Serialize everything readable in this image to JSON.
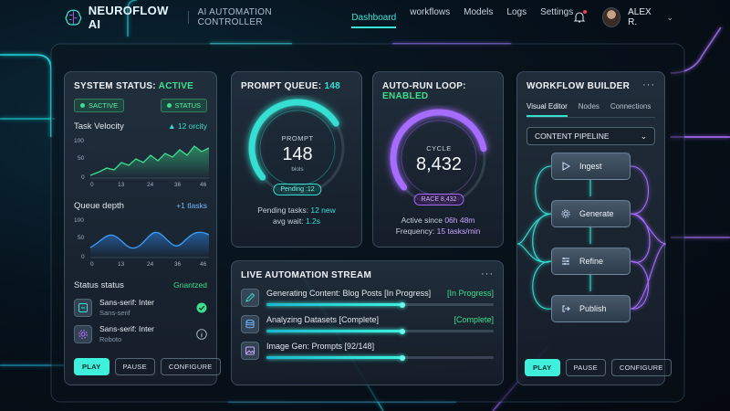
{
  "app": {
    "brand": "NEUROFLOW AI",
    "subtitle": "AI AUTOMATION CONTROLLER",
    "nav": [
      "Dashboard",
      "workflows",
      "Models",
      "Logs",
      "Settings"
    ],
    "active_nav": "Dashboard",
    "user": "ALEX R."
  },
  "system_status": {
    "title": "SYSTEM STATUS:",
    "status": "ACTIVE",
    "pill_left": "SACTIVE",
    "pill_right": "STATUS",
    "velocity_label": "Task Velocity",
    "velocity_delta": "▲ 12 orcity",
    "queue_label": "Queue depth",
    "queue_delta": "+1 tlasks",
    "y_ticks": [
      "100",
      "50",
      "0"
    ],
    "x_ticks": [
      "0",
      "13",
      "24",
      "36",
      "46"
    ],
    "status_status_label": "Status status",
    "status_status_value": "Gnantzed",
    "items": [
      {
        "title": "Sans-serif: Inter",
        "sub": "Sans-serif"
      },
      {
        "title": "Sans-serif: Inter",
        "sub": "Roboto"
      }
    ],
    "buttons": [
      "PLAY",
      "PAUSE",
      "CONFIGURE"
    ]
  },
  "prompt_queue": {
    "title": "PROMPT QUEUE:",
    "count": "148",
    "gauge_label": "PROMPT",
    "gauge_value": "148",
    "gauge_sub": "blols",
    "chip": "Pending :12",
    "pending_label": "Pending tasks:",
    "pending_value": "12 new",
    "wait_label": "avg wait:",
    "wait_value": "1.2s",
    "gauge_fraction": 0.72,
    "accent": "#35e0d2"
  },
  "auto_run": {
    "title": "AUTO-RUN LOOP:",
    "status": "ENABLED",
    "gauge_label": "CYCLE",
    "gauge_value": "8,432",
    "chip": "RACE 8,432",
    "active_label": "Active since",
    "active_value": "06h 48m",
    "freq_label": "Frequency:",
    "freq_value": "15 tasks/min",
    "gauge_fraction": 0.8,
    "accent": "#a66bff"
  },
  "live_stream": {
    "title": "LIVE AUTOMATION STREAM",
    "items": [
      {
        "text": "Generating Content: Blog Posts [In Progress]",
        "status": "[In Progress]",
        "progress": 0.6
      },
      {
        "text": "Analyzing Datasets [Complete]",
        "status": "[Complete]",
        "progress": 0.6
      },
      {
        "text": "Image Gen: Prompts [92/148]",
        "status": "",
        "progress": 0.6
      }
    ]
  },
  "workflow": {
    "title": "WORKFLOW BUILDER",
    "tabs": [
      "Visual Editor",
      "Nodes",
      "Connections"
    ],
    "select": "CONTENT PIPELINE",
    "nodes": [
      "Ingest",
      "Generate",
      "Refine",
      "Publish"
    ],
    "buttons": [
      "PLAY",
      "PAUSE",
      "CONFIGURE"
    ]
  }
}
